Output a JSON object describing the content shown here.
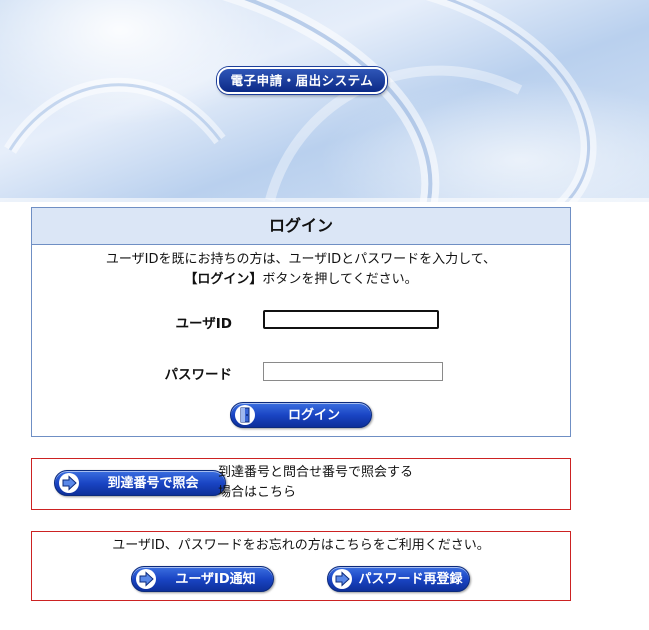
{
  "banner": {
    "title": "電子申請・届出システム"
  },
  "login": {
    "heading": "ログイン",
    "instruction_line1": "ユーザIDを既にお持ちの方は、ユーザIDとパスワードを入力して、",
    "instruction_bold": "【ログイン】",
    "instruction_line2_rest": "ボタンを押してください。",
    "userid_label": "ユーザID",
    "userid_value": "",
    "password_label": "パスワード",
    "password_value": "",
    "login_button": "ログイン"
  },
  "inquiry": {
    "button_label": "到達番号で照会",
    "text_line1": "到達番号と問合せ番号で照会する",
    "text_line2": "場合はこちら"
  },
  "forgot": {
    "text": "ユーザID、パスワードをお忘れの方はこちらをご利用ください。",
    "userid_notify_button": "ユーザID通知",
    "password_reregister_button": "パスワード再登録"
  },
  "colors": {
    "button_blue": "#1a45c4",
    "header_bg": "#dbe6f6",
    "box_border_blue": "#6f8fc4",
    "box_border_red": "#cc2222"
  },
  "icons": {
    "login_button": "door-icon",
    "inquiry_button": "arrow-right-icon",
    "userid_notify_button": "arrow-right-icon",
    "password_reregister_button": "arrow-right-icon"
  }
}
